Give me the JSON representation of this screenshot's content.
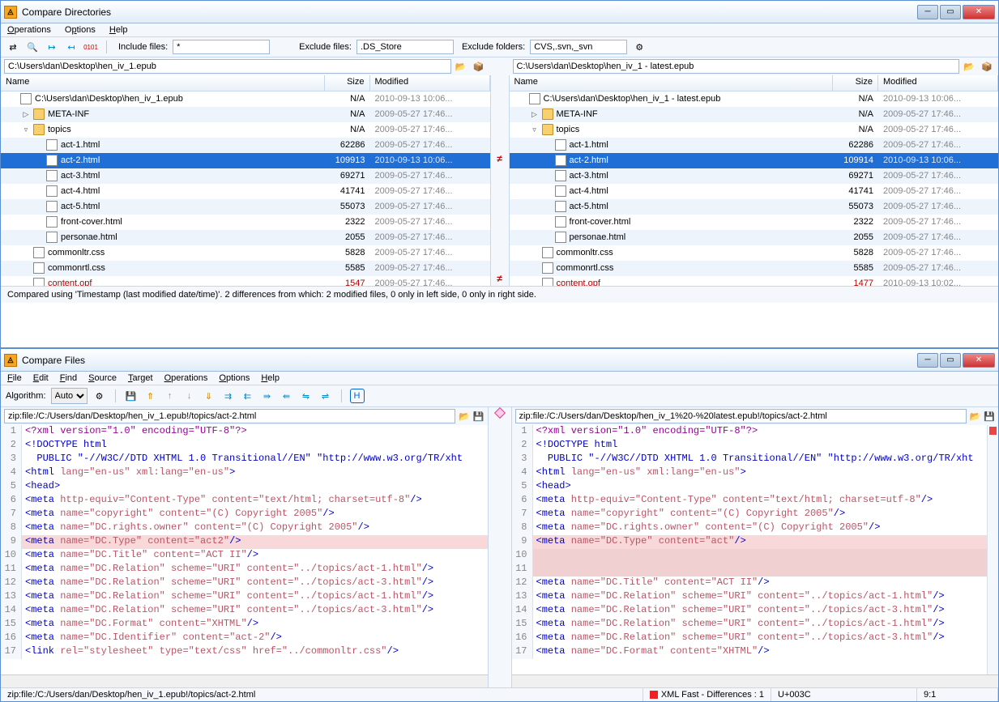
{
  "win1": {
    "title": "Compare Directories",
    "menus": [
      "Operations",
      "Options",
      "Help"
    ],
    "toolbar": {
      "include_label": "Include files:",
      "include_value": "*",
      "exclude_label": "Exclude files:",
      "exclude_value": ".DS_Store",
      "exclude_folders_label": "Exclude folders:",
      "exclude_folders_value": "CVS,.svn,_svn"
    },
    "left_path": "C:\\Users\\dan\\Desktop\\hen_iv_1.epub",
    "right_path": "C:\\Users\\dan\\Desktop\\hen_iv_1 - latest.epub",
    "cols": {
      "name": "Name",
      "size": "Size",
      "mod": "Modified"
    },
    "left_rows": [
      {
        "indent": 0,
        "tog": "",
        "icon": "epub",
        "name": "C:\\Users\\dan\\Desktop\\hen_iv_1.epub",
        "size": "N/A",
        "mod": "2010-09-13  10:06...",
        "alt": false,
        "diff": false,
        "sel": false
      },
      {
        "indent": 1,
        "tog": "▷",
        "icon": "folder",
        "name": "META-INF",
        "size": "N/A",
        "mod": "2009-05-27  17:46...",
        "alt": true,
        "diff": false,
        "sel": false
      },
      {
        "indent": 1,
        "tog": "▿",
        "icon": "folder",
        "name": "topics",
        "size": "N/A",
        "mod": "2009-05-27  17:46...",
        "alt": false,
        "diff": false,
        "sel": false
      },
      {
        "indent": 2,
        "tog": "",
        "icon": "html",
        "name": "act-1.html",
        "size": "62286",
        "mod": "2009-05-27  17:46...",
        "alt": true,
        "diff": false,
        "sel": false
      },
      {
        "indent": 2,
        "tog": "",
        "icon": "html",
        "name": "act-2.html",
        "size": "109913",
        "mod": "2010-09-13  10:06...",
        "alt": false,
        "diff": true,
        "sel": true
      },
      {
        "indent": 2,
        "tog": "",
        "icon": "html",
        "name": "act-3.html",
        "size": "69271",
        "mod": "2009-05-27  17:46...",
        "alt": true,
        "diff": false,
        "sel": false
      },
      {
        "indent": 2,
        "tog": "",
        "icon": "html",
        "name": "act-4.html",
        "size": "41741",
        "mod": "2009-05-27  17:46...",
        "alt": false,
        "diff": false,
        "sel": false
      },
      {
        "indent": 2,
        "tog": "",
        "icon": "html",
        "name": "act-5.html",
        "size": "55073",
        "mod": "2009-05-27  17:46...",
        "alt": true,
        "diff": false,
        "sel": false
      },
      {
        "indent": 2,
        "tog": "",
        "icon": "html",
        "name": "front-cover.html",
        "size": "2322",
        "mod": "2009-05-27  17:46...",
        "alt": false,
        "diff": false,
        "sel": false
      },
      {
        "indent": 2,
        "tog": "",
        "icon": "html",
        "name": "personae.html",
        "size": "2055",
        "mod": "2009-05-27  17:46...",
        "alt": true,
        "diff": false,
        "sel": false
      },
      {
        "indent": 1,
        "tog": "",
        "icon": "css",
        "name": "commonltr.css",
        "size": "5828",
        "mod": "2009-05-27  17:46...",
        "alt": false,
        "diff": false,
        "sel": false
      },
      {
        "indent": 1,
        "tog": "",
        "icon": "css",
        "name": "commonrtl.css",
        "size": "5585",
        "mod": "2009-05-27  17:46...",
        "alt": true,
        "diff": false,
        "sel": false
      },
      {
        "indent": 1,
        "tog": "",
        "icon": "file",
        "name": "content.opf",
        "size": "1547",
        "mod": "2009-05-27  17:46...",
        "alt": false,
        "diff": true,
        "sel": false
      }
    ],
    "right_rows": [
      {
        "indent": 0,
        "tog": "",
        "icon": "epub",
        "name": "C:\\Users\\dan\\Desktop\\hen_iv_1 - latest.epub",
        "size": "N/A",
        "mod": "2010-09-13  10:06...",
        "alt": false,
        "diff": false,
        "sel": false
      },
      {
        "indent": 1,
        "tog": "▷",
        "icon": "folder",
        "name": "META-INF",
        "size": "N/A",
        "mod": "2009-05-27  17:46...",
        "alt": true,
        "diff": false,
        "sel": false
      },
      {
        "indent": 1,
        "tog": "▿",
        "icon": "folder",
        "name": "topics",
        "size": "N/A",
        "mod": "2009-05-27  17:46...",
        "alt": false,
        "diff": false,
        "sel": false
      },
      {
        "indent": 2,
        "tog": "",
        "icon": "html",
        "name": "act-1.html",
        "size": "62286",
        "mod": "2009-05-27  17:46...",
        "alt": true,
        "diff": false,
        "sel": false
      },
      {
        "indent": 2,
        "tog": "",
        "icon": "html",
        "name": "act-2.html",
        "size": "109914",
        "mod": "2010-09-13  10:06...",
        "alt": false,
        "diff": true,
        "sel": true
      },
      {
        "indent": 2,
        "tog": "",
        "icon": "html",
        "name": "act-3.html",
        "size": "69271",
        "mod": "2009-05-27  17:46...",
        "alt": true,
        "diff": false,
        "sel": false
      },
      {
        "indent": 2,
        "tog": "",
        "icon": "html",
        "name": "act-4.html",
        "size": "41741",
        "mod": "2009-05-27  17:46...",
        "alt": false,
        "diff": false,
        "sel": false
      },
      {
        "indent": 2,
        "tog": "",
        "icon": "html",
        "name": "act-5.html",
        "size": "55073",
        "mod": "2009-05-27  17:46...",
        "alt": true,
        "diff": false,
        "sel": false
      },
      {
        "indent": 2,
        "tog": "",
        "icon": "html",
        "name": "front-cover.html",
        "size": "2322",
        "mod": "2009-05-27  17:46...",
        "alt": false,
        "diff": false,
        "sel": false
      },
      {
        "indent": 2,
        "tog": "",
        "icon": "html",
        "name": "personae.html",
        "size": "2055",
        "mod": "2009-05-27  17:46...",
        "alt": true,
        "diff": false,
        "sel": false
      },
      {
        "indent": 1,
        "tog": "",
        "icon": "css",
        "name": "commonltr.css",
        "size": "5828",
        "mod": "2009-05-27  17:46...",
        "alt": false,
        "diff": false,
        "sel": false
      },
      {
        "indent": 1,
        "tog": "",
        "icon": "css",
        "name": "commonrtl.css",
        "size": "5585",
        "mod": "2009-05-27  17:46...",
        "alt": true,
        "diff": false,
        "sel": false
      },
      {
        "indent": 1,
        "tog": "",
        "icon": "file",
        "name": "content.opf",
        "size": "1477",
        "mod": "2010-09-13  10:02...",
        "alt": false,
        "diff": true,
        "sel": false
      }
    ],
    "diff_marks": [
      "",
      "",
      "",
      "",
      "≠",
      "",
      "",
      "",
      "",
      "",
      "",
      "",
      "≠"
    ],
    "status": "Compared using 'Timestamp (last modified date/time)'. 2 differences from which: 2 modified files, 0 only in left side, 0 only in right side."
  },
  "win2": {
    "title": "Compare Files",
    "menus": [
      "File",
      "Edit",
      "Find",
      "Source",
      "Target",
      "Operations",
      "Options",
      "Help"
    ],
    "algo_label": "Algorithm:",
    "algo_value": "Auto",
    "left_path": "zip:file:/C:/Users/dan/Desktop/hen_iv_1.epub!/topics/act-2.html",
    "right_path": "zip:file:/C:/Users/dan/Desktop/hen_iv_1%20-%20latest.epub!/topics/act-2.html",
    "left_lines": [
      {
        "n": 1,
        "html": "<span class='tok-pi'>&lt;?xml version=\"1.0\" encoding=\"UTF-8\"?&gt;</span>",
        "diff": false
      },
      {
        "n": 2,
        "html": "<span class='tok-doctype'>&lt;!DOCTYPE html</span>",
        "diff": false
      },
      {
        "n": 3,
        "html": "<span class='tok-doctype'>  PUBLIC \"-//W3C//DTD XHTML 1.0 Transitional//EN\" \"http://www.w3.org/TR/xht</span>",
        "diff": false
      },
      {
        "n": 4,
        "html": "<span class='tok-punct'>&lt;</span><span class='tok-tag'>html</span> <span class='tok-attr'>lang=\"en-us\"</span> <span class='tok-attr'>xml:lang=\"en-us\"</span><span class='tok-punct'>&gt;</span>",
        "diff": false
      },
      {
        "n": 5,
        "html": "<span class='tok-punct'>&lt;</span><span class='tok-tag'>head</span><span class='tok-punct'>&gt;</span>",
        "diff": false
      },
      {
        "n": 6,
        "html": "<span class='tok-punct'>&lt;</span><span class='tok-tag'>meta</span> <span class='tok-attr'>http-equiv=\"Content-Type\"</span> <span class='tok-attr'>content=\"text/html; charset=utf-8\"</span><span class='tok-punct'>/&gt;</span>",
        "diff": false
      },
      {
        "n": 7,
        "html": "<span class='tok-punct'>&lt;</span><span class='tok-tag'>meta</span> <span class='tok-attr'>name=\"copyright\"</span> <span class='tok-attr'>content=\"(C) Copyright 2005\"</span><span class='tok-punct'>/&gt;</span>",
        "diff": false
      },
      {
        "n": 8,
        "html": "<span class='tok-punct'>&lt;</span><span class='tok-tag'>meta</span> <span class='tok-attr'>name=\"DC.rights.owner\"</span> <span class='tok-attr'>content=\"(C) Copyright 2005\"</span><span class='tok-punct'>/&gt;</span>",
        "diff": false
      },
      {
        "n": 9,
        "html": "<span class='tok-punct'>&lt;</span><span class='tok-tag'>meta</span> <span class='tok-attr'>name=\"DC.Type\"</span> <span class='tok-attr'>content=\"act2\"</span><span class='tok-punct'>/&gt;</span>",
        "diff": true
      },
      {
        "n": 10,
        "html": "<span class='tok-punct'>&lt;</span><span class='tok-tag'>meta</span> <span class='tok-attr'>name=\"DC.Title\"</span> <span class='tok-attr'>content=\"ACT II\"</span><span class='tok-punct'>/&gt;</span>",
        "diff": false
      },
      {
        "n": 11,
        "html": "<span class='tok-punct'>&lt;</span><span class='tok-tag'>meta</span> <span class='tok-attr'>name=\"DC.Relation\"</span> <span class='tok-attr'>scheme=\"URI\"</span> <span class='tok-attr'>content=\"../topics/act-1.html\"</span><span class='tok-punct'>/&gt;</span>",
        "diff": false
      },
      {
        "n": 12,
        "html": "<span class='tok-punct'>&lt;</span><span class='tok-tag'>meta</span> <span class='tok-attr'>name=\"DC.Relation\"</span> <span class='tok-attr'>scheme=\"URI\"</span> <span class='tok-attr'>content=\"../topics/act-3.html\"</span><span class='tok-punct'>/&gt;</span>",
        "diff": false
      },
      {
        "n": 13,
        "html": "<span class='tok-punct'>&lt;</span><span class='tok-tag'>meta</span> <span class='tok-attr'>name=\"DC.Relation\"</span> <span class='tok-attr'>scheme=\"URI\"</span> <span class='tok-attr'>content=\"../topics/act-1.html\"</span><span class='tok-punct'>/&gt;</span>",
        "diff": false
      },
      {
        "n": 14,
        "html": "<span class='tok-punct'>&lt;</span><span class='tok-tag'>meta</span> <span class='tok-attr'>name=\"DC.Relation\"</span> <span class='tok-attr'>scheme=\"URI\"</span> <span class='tok-attr'>content=\"../topics/act-3.html\"</span><span class='tok-punct'>/&gt;</span>",
        "diff": false
      },
      {
        "n": 15,
        "html": "<span class='tok-punct'>&lt;</span><span class='tok-tag'>meta</span> <span class='tok-attr'>name=\"DC.Format\"</span> <span class='tok-attr'>content=\"XHTML\"</span><span class='tok-punct'>/&gt;</span>",
        "diff": false
      },
      {
        "n": 16,
        "html": "<span class='tok-punct'>&lt;</span><span class='tok-tag'>meta</span> <span class='tok-attr'>name=\"DC.Identifier\"</span> <span class='tok-attr'>content=\"act-2\"</span><span class='tok-punct'>/&gt;</span>",
        "diff": false
      },
      {
        "n": 17,
        "html": "<span class='tok-punct'>&lt;</span><span class='tok-tag'>link</span> <span class='tok-attr'>rel=\"stylesheet\"</span> <span class='tok-attr'>type=\"text/css\"</span> <span class='tok-attr'>href=\"../commonltr.css\"</span><span class='tok-punct'>/&gt;</span>",
        "diff": false
      }
    ],
    "right_lines": [
      {
        "n": 1,
        "html": "<span class='tok-pi'>&lt;?xml version=\"1.0\" encoding=\"UTF-8\"?&gt;</span>",
        "diff": false
      },
      {
        "n": 2,
        "html": "<span class='tok-doctype'>&lt;!DOCTYPE html</span>",
        "diff": false
      },
      {
        "n": 3,
        "html": "<span class='tok-doctype'>  PUBLIC \"-//W3C//DTD XHTML 1.0 Transitional//EN\" \"http://www.w3.org/TR/xht</span>",
        "diff": false
      },
      {
        "n": 4,
        "html": "<span class='tok-punct'>&lt;</span><span class='tok-tag'>html</span> <span class='tok-attr'>lang=\"en-us\"</span> <span class='tok-attr'>xml:lang=\"en-us\"</span><span class='tok-punct'>&gt;</span>",
        "diff": false
      },
      {
        "n": 5,
        "html": "<span class='tok-punct'>&lt;</span><span class='tok-tag'>head</span><span class='tok-punct'>&gt;</span>",
        "diff": false
      },
      {
        "n": 6,
        "html": "<span class='tok-punct'>&lt;</span><span class='tok-tag'>meta</span> <span class='tok-attr'>http-equiv=\"Content-Type\"</span> <span class='tok-attr'>content=\"text/html; charset=utf-8\"</span><span class='tok-punct'>/&gt;</span>",
        "diff": false
      },
      {
        "n": 7,
        "html": "<span class='tok-punct'>&lt;</span><span class='tok-tag'>meta</span> <span class='tok-attr'>name=\"copyright\"</span> <span class='tok-attr'>content=\"(C) Copyright 2005\"</span><span class='tok-punct'>/&gt;</span>",
        "diff": false
      },
      {
        "n": 8,
        "html": "<span class='tok-punct'>&lt;</span><span class='tok-tag'>meta</span> <span class='tok-attr'>name=\"DC.rights.owner\"</span> <span class='tok-attr'>content=\"(C) Copyright 2005\"</span><span class='tok-punct'>/&gt;</span>",
        "diff": false
      },
      {
        "n": 9,
        "html": "<span class='tok-punct'>&lt;</span><span class='tok-tag'>meta</span> <span class='tok-attr'>name=\"DC.Type\"</span> <span class='tok-attr'>content=\"act\"</span><span class='tok-punct'>/&gt;</span>",
        "diff": true
      },
      {
        "n": 10,
        "html": "",
        "diff": true,
        "empty": true
      },
      {
        "n": 11,
        "html": "",
        "diff": true,
        "empty": true
      },
      {
        "n": 12,
        "html": "<span class='tok-punct'>&lt;</span><span class='tok-tag'>meta</span> <span class='tok-attr'>name=\"DC.Title\"</span> <span class='tok-attr'>content=\"ACT II\"</span><span class='tok-punct'>/&gt;</span>",
        "diff": false
      },
      {
        "n": 13,
        "html": "<span class='tok-punct'>&lt;</span><span class='tok-tag'>meta</span> <span class='tok-attr'>name=\"DC.Relation\"</span> <span class='tok-attr'>scheme=\"URI\"</span> <span class='tok-attr'>content=\"../topics/act-1.html\"</span><span class='tok-punct'>/&gt;</span>",
        "diff": false
      },
      {
        "n": 14,
        "html": "<span class='tok-punct'>&lt;</span><span class='tok-tag'>meta</span> <span class='tok-attr'>name=\"DC.Relation\"</span> <span class='tok-attr'>scheme=\"URI\"</span> <span class='tok-attr'>content=\"../topics/act-3.html\"</span><span class='tok-punct'>/&gt;</span>",
        "diff": false
      },
      {
        "n": 15,
        "html": "<span class='tok-punct'>&lt;</span><span class='tok-tag'>meta</span> <span class='tok-attr'>name=\"DC.Relation\"</span> <span class='tok-attr'>scheme=\"URI\"</span> <span class='tok-attr'>content=\"../topics/act-1.html\"</span><span class='tok-punct'>/&gt;</span>",
        "diff": false
      },
      {
        "n": 16,
        "html": "<span class='tok-punct'>&lt;</span><span class='tok-tag'>meta</span> <span class='tok-attr'>name=\"DC.Relation\"</span> <span class='tok-attr'>scheme=\"URI\"</span> <span class='tok-attr'>content=\"../topics/act-3.html\"</span><span class='tok-punct'>/&gt;</span>",
        "diff": false
      },
      {
        "n": 17,
        "html": "<span class='tok-punct'>&lt;</span><span class='tok-tag'>meta</span> <span class='tok-attr'>name=\"DC.Format\"</span> <span class='tok-attr'>content=\"XHTML\"</span><span class='tok-punct'>/&gt;</span>",
        "diff": false
      }
    ],
    "status": {
      "path": "zip:file:/C:/Users/dan/Desktop/hen_iv_1.epub!/topics/act-2.html",
      "mode": "XML Fast - Differences : 1",
      "codepoint": "U+003C",
      "pos": "9:1"
    }
  }
}
